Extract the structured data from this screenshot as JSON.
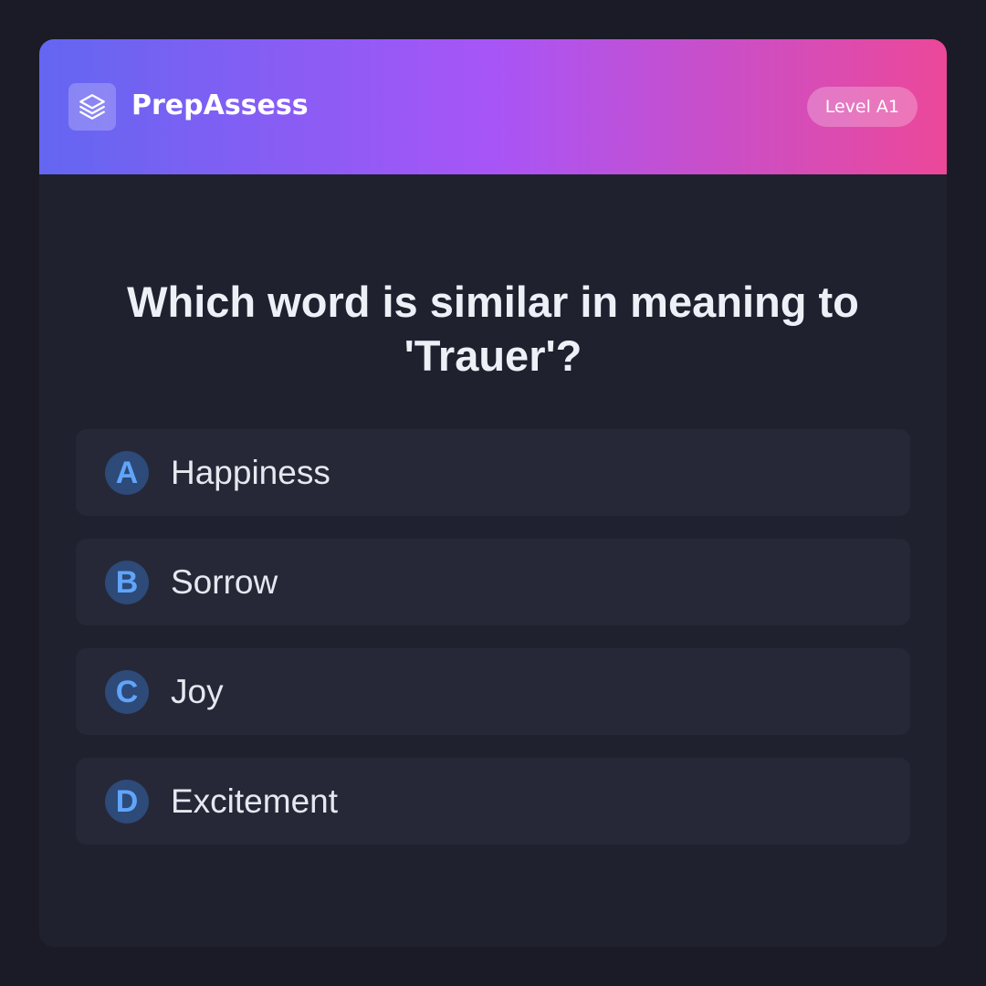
{
  "header": {
    "brand": "PrepAssess",
    "logo_icon": "layers-icon",
    "level_badge": "Level A1"
  },
  "question": {
    "text": "Which word is similar in meaning to 'Trauer'?"
  },
  "options": [
    {
      "letter": "A",
      "label": "Happiness"
    },
    {
      "letter": "B",
      "label": "Sorrow"
    },
    {
      "letter": "C",
      "label": "Joy"
    },
    {
      "letter": "D",
      "label": "Excitement"
    }
  ],
  "colors": {
    "background": "#1a1b26",
    "card": "#1f212e",
    "option_bg": "#262837",
    "gradient_start": "#6366f1",
    "gradient_mid": "#a855f7",
    "gradient_end": "#ec4899",
    "letter_circle": "#2d4a78",
    "letter_text": "#60a5fa"
  }
}
